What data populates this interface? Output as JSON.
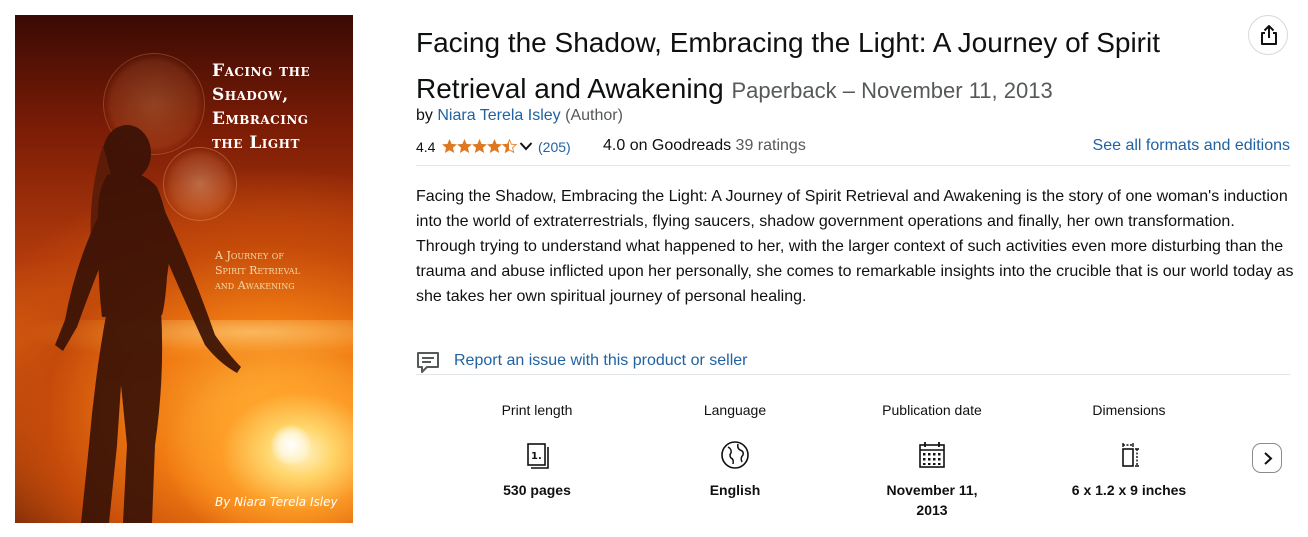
{
  "cover": {
    "title": "Facing the\nShadow,\nEmbracing\nthe Light",
    "subtitle": "A Journey of\nSpirit Retrieval\nand Awakening",
    "author": "By Niara Terela Isley"
  },
  "product": {
    "title": "Facing the Shadow, Embracing the Light: A Journey of Spirit Retrieval and Awakening",
    "format": "Paperback – November 11, 2013",
    "by_prefix": "by",
    "author": "Niara Terela Isley",
    "author_role": "(Author)"
  },
  "share_icon": "share-icon",
  "ratings": {
    "average": "4.4",
    "stars": 4.4,
    "count": "(205)",
    "goodreads": "4.0 on Goodreads",
    "goodreads_count": "39 ratings",
    "star_color": "#de7921"
  },
  "formats_link": "See all formats and editions",
  "description": "Facing the Shadow, Embracing the Light: A Journey of Spirit Retrieval and Awakening is the story of one woman's induction into the world of extraterrestrials, flying saucers, shadow government operations and finally, her own transformation. Through trying to understand what happened to her, with the larger context of such activities even more disturbing than the trauma and abuse inflicted upon her personally, she comes to remarkable insights into the crucible that is our world today as she takes her own spiritual journey of personal healing.",
  "report_link": "Report an issue with this product or seller",
  "specs": [
    {
      "label": "Print length",
      "icon": "book-pages-icon",
      "value": "530 pages"
    },
    {
      "label": "Language",
      "icon": "globe-icon",
      "value": "English"
    },
    {
      "label": "Publication date",
      "icon": "calendar-icon",
      "value": "November 11, 2013"
    },
    {
      "label": "Dimensions",
      "icon": "dimensions-icon",
      "value": "6 x 1.2 x 9 inches"
    }
  ],
  "colors": {
    "link": "#2162a1",
    "text": "#0f1111",
    "muted": "#565959"
  }
}
